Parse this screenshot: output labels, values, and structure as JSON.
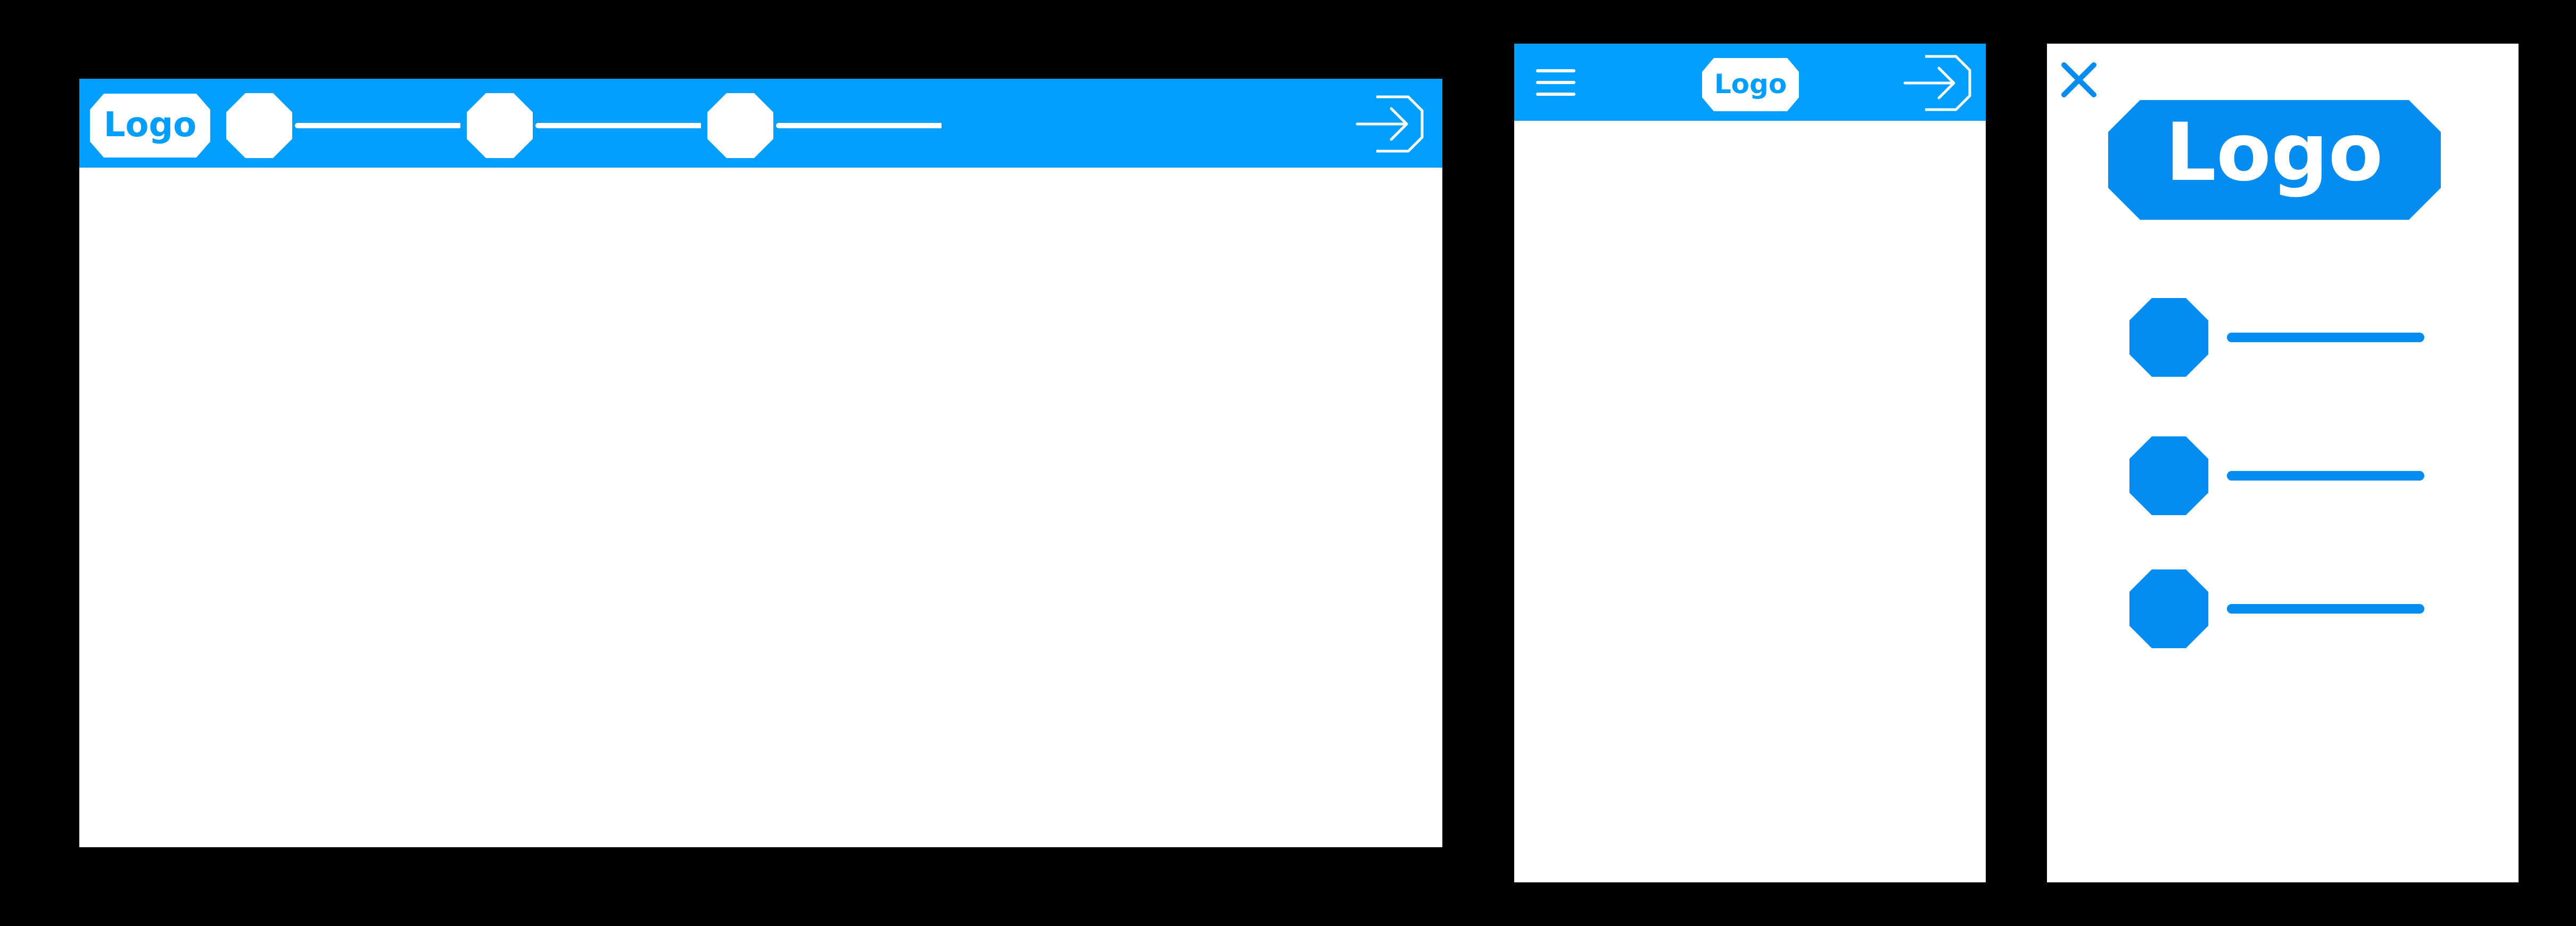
{
  "colors": {
    "background": "#000000",
    "header_blue": "#009FFF",
    "accent_blue": "#058CF0",
    "surface": "#FFFFFF"
  },
  "desktop": {
    "logo_text": "Logo",
    "nav_items": [
      "nav-item-1",
      "nav-item-2",
      "nav-item-3"
    ],
    "login_icon": "login-icon"
  },
  "mobile": {
    "logo_text": "Logo",
    "menu_icon": "hamburger-icon",
    "login_icon": "login-icon"
  },
  "drawer": {
    "logo_text": "Logo",
    "close_icon": "close-icon",
    "menu_items": [
      "menu-item-1",
      "menu-item-2",
      "menu-item-3"
    ]
  }
}
